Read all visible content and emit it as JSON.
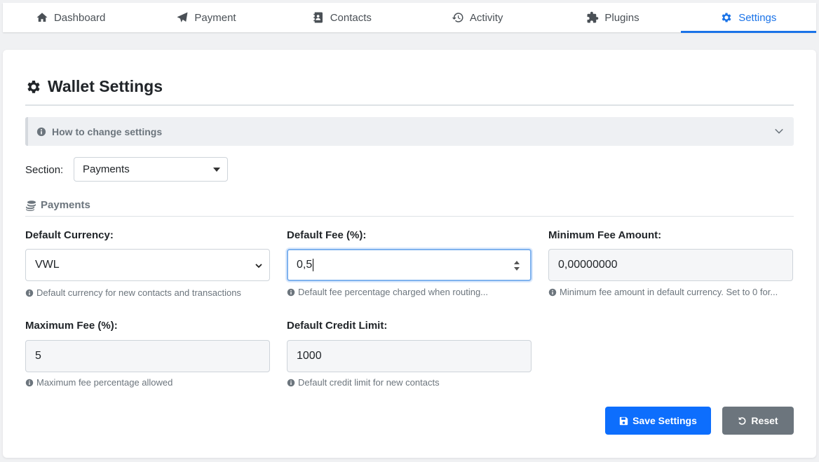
{
  "tabs": [
    {
      "label": "Dashboard",
      "icon": "home-icon"
    },
    {
      "label": "Payment",
      "icon": "paper-plane-icon"
    },
    {
      "label": "Contacts",
      "icon": "address-book-icon"
    },
    {
      "label": "Activity",
      "icon": "history-icon"
    },
    {
      "label": "Plugins",
      "icon": "puzzle-icon"
    },
    {
      "label": "Settings",
      "icon": "gear-icon",
      "active": true
    }
  ],
  "card": {
    "title": "Wallet Settings",
    "howto_label": "How to change settings",
    "section_label": "Section:",
    "section_value": "Payments",
    "group_title": "Payments"
  },
  "fields": {
    "default_currency": {
      "label": "Default Currency:",
      "value": "VWL",
      "help": "Default currency for new contacts and transactions"
    },
    "default_fee": {
      "label": "Default Fee (%):",
      "value": "0,5",
      "help": "Default fee percentage charged when routing..."
    },
    "min_fee": {
      "label": "Minimum Fee Amount:",
      "value": "0,00000000",
      "help": "Minimum fee amount in default currency. Set to 0 for..."
    },
    "max_fee": {
      "label": "Maximum Fee (%):",
      "value": "5",
      "help": "Maximum fee percentage allowed"
    },
    "credit_limit": {
      "label": "Default Credit Limit:",
      "value": "1000",
      "help": "Default credit limit for new contacts"
    }
  },
  "buttons": {
    "save": "Save Settings",
    "reset": "Reset"
  },
  "colors": {
    "accent": "#1a73e8",
    "primary_button": "#0d6efd",
    "secondary_button": "#6c757d"
  }
}
